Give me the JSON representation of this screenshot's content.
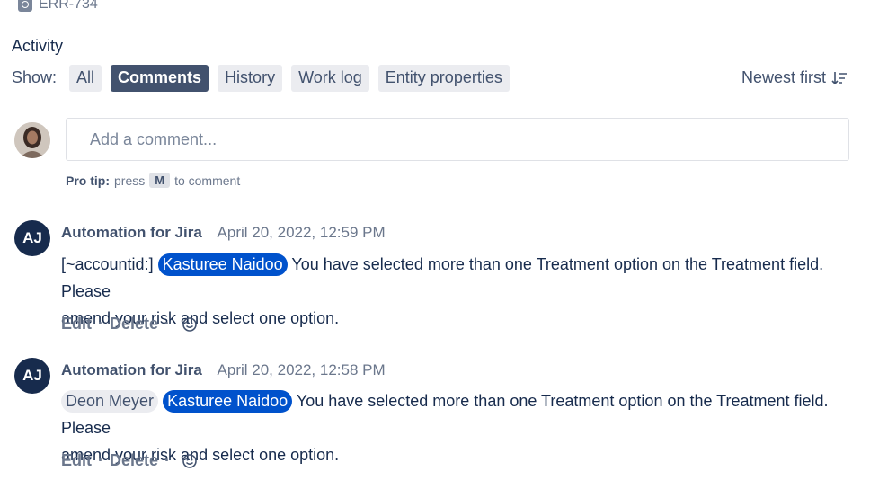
{
  "issue": {
    "key": "ERR-734"
  },
  "activity": {
    "heading": "Activity",
    "show_label": "Show:",
    "filters": [
      "All",
      "Comments",
      "History",
      "Work log",
      "Entity properties"
    ],
    "selected_filter": "Comments",
    "sort_label": "Newest first"
  },
  "composer": {
    "placeholder": "Add a comment...",
    "pro_tip_bold": "Pro tip:",
    "pro_tip_press": "press",
    "pro_tip_key": "M",
    "pro_tip_rest": "to comment"
  },
  "comments": [
    {
      "avatar_initials": "AJ",
      "author": "Automation for Jira",
      "date": "April 20, 2022, 12:59 PM",
      "prefix": "[~accountid:]",
      "mention": "Kasturee Naidoo",
      "text_line1": "You have selected more than one Treatment option on the Treatment field. Please",
      "text_line2": "amend your risk and select one option.",
      "edit_label": "Edit",
      "delete_label": "Delete"
    },
    {
      "avatar_initials": "AJ",
      "author": "Automation for Jira",
      "date": "April 20, 2022, 12:58 PM",
      "plain_mention": "Deon Meyer",
      "mention": "Kasturee Naidoo",
      "text_line1": "You have selected more than one Treatment option on the Treatment field. Please",
      "text_line2": "amend your risk and select one option.",
      "edit_label": "Edit",
      "delete_label": "Delete"
    }
  ],
  "colors": {
    "primary_text": "#172b4d",
    "secondary_text": "#42526e",
    "subtle_text": "#6b778c",
    "selected_filter_bg": "#42526e",
    "mention_bg": "#0052cc",
    "avatar_bg": "#172b4d"
  }
}
